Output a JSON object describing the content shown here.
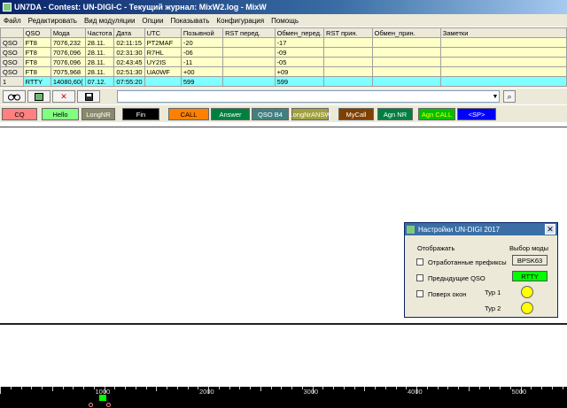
{
  "title": "UN7DA - Contest: UN-DIGI-C - Текущий журнал: MixW2.log - MixW",
  "menu": [
    "Файл",
    "Редактировать",
    "Вид модуляции",
    "Опции",
    "Показывать",
    "Конфигурация",
    "Помощь"
  ],
  "log": {
    "columns": [
      "QSO",
      "Мода",
      "Частота",
      "Дата",
      "UTC",
      "Позывной",
      "RST перед.",
      "Обмен_перед.",
      "RST прин.",
      "Обмен_прин.",
      "Заметки"
    ],
    "rows": [
      [
        "QSO",
        "FT8",
        "7076,232",
        "28.11.",
        "02:11:15",
        "PT2MAF",
        "-20",
        "",
        "-17",
        "",
        ""
      ],
      [
        "QSO",
        "FT8",
        "7076,096",
        "28.11.",
        "02:31:30",
        "R7HL",
        "-06",
        "",
        "-09",
        "",
        ""
      ],
      [
        "QSO",
        "FT8",
        "7076,096",
        "28.11.",
        "02:43:45",
        "UY2IS",
        "-11",
        "",
        "-05",
        "",
        ""
      ],
      [
        "QSO",
        "FT8",
        "7075,968",
        "28.11.",
        "02:51:30",
        "UA0WF",
        "+00",
        "",
        "+09",
        "",
        ""
      ],
      [
        "1",
        "RTTY",
        "14080,60(",
        "07.12.",
        "07:55:20",
        "",
        "599",
        "",
        "599",
        "",
        ""
      ]
    ]
  },
  "toolbar": {
    "icons": [
      "binoculars-icon",
      "map-icon",
      "delete-icon",
      "save-icon"
    ],
    "delete_glyph": "✕",
    "search_glyph": "⌕"
  },
  "macros": [
    {
      "label": "CQ",
      "bg": "#ff8080",
      "fg": "#000000"
    },
    {
      "label": "Hello",
      "bg": "#80ff80",
      "fg": "#000000"
    },
    {
      "label": "LongNR",
      "bg": "#8a8a6a",
      "fg": "#ffffff"
    },
    {
      "label": "Fin",
      "bg": "#000000",
      "fg": "#ffffff"
    },
    {
      "label": "CALL",
      "bg": "#ff8000",
      "fg": "#000000"
    },
    {
      "label": "Answer",
      "bg": "#008040",
      "fg": "#ffffff"
    },
    {
      "label": "QSO B4",
      "bg": "#408080",
      "fg": "#ffffff"
    },
    {
      "label": "LongNrANSW",
      "bg": "#a0a040",
      "fg": "#ffffff"
    },
    {
      "label": "MyCall",
      "bg": "#804000",
      "fg": "#ffffff"
    },
    {
      "label": "Agn NR",
      "bg": "#008040",
      "fg": "#ffffff"
    },
    {
      "label": "Agn CALL",
      "bg": "#00c000",
      "fg": "#ffff00"
    },
    {
      "label": "<SP>",
      "bg": "#0000ff",
      "fg": "#ffffff"
    }
  ],
  "scale": {
    "labels": [
      "1000",
      "2000",
      "3000",
      "4000",
      "5000"
    ]
  },
  "dialog": {
    "title": "Настройки UN-DIGI 2017",
    "close": "✕",
    "display_label": "Отображать",
    "mode_label": "Выбор моды",
    "options": [
      "Отработанные префиксы",
      "Предыдущие QSO",
      "Поверх окон"
    ],
    "mode_buttons": [
      {
        "label": "BPSK63",
        "bg": "#ece9d8"
      },
      {
        "label": "RTTY",
        "bg": "#00ff00"
      }
    ],
    "tours": [
      "Тур 1",
      "Тур 2"
    ]
  }
}
